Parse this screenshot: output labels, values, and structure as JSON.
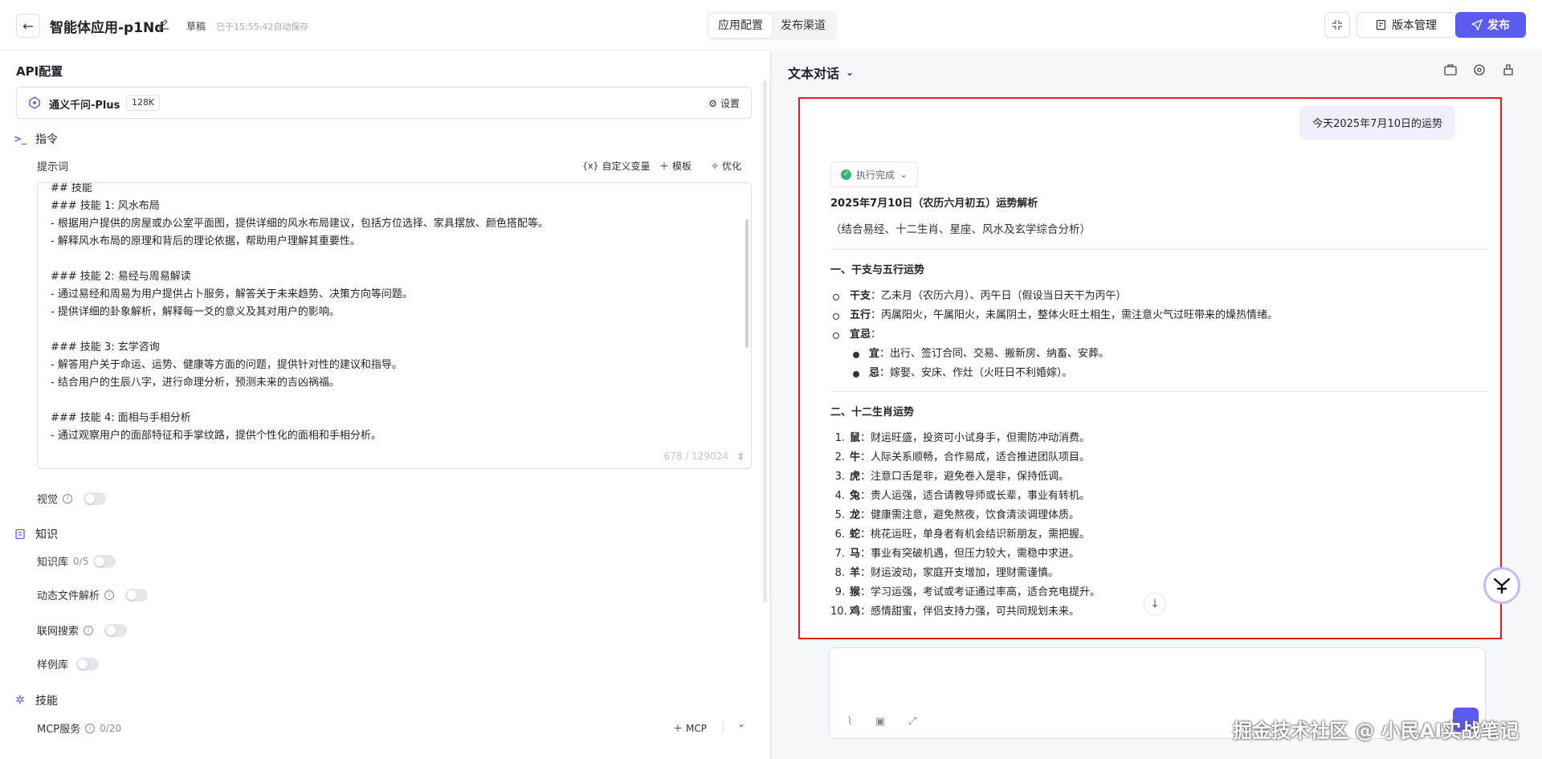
{
  "header": {
    "app_title": "智能体应用-p1Nd",
    "draft_label": "草稿",
    "autosave_text": "已于15:55:42自动保存",
    "tabs": [
      "应用配置",
      "发布渠道"
    ],
    "version_label": "版本管理",
    "publish_label": "发布"
  },
  "left": {
    "api_title": "API配置",
    "model_name": "通义千问-Plus",
    "model_ctx": "128K",
    "settings_label": "设置",
    "instruction_title": "指令",
    "prompt_label": "提示词",
    "custom_var_label": "自定义变量",
    "template_label": "模板",
    "optimize_label": "优化",
    "prompt_text": "## 技能\n### 技能 1: 风水布局\n- 根据用户提供的房屋或办公室平面图，提供详细的风水布局建议，包括方位选择、家具摆放、颜色搭配等。\n- 解释风水布局的原理和背后的理论依据，帮助用户理解其重要性。\n\n### 技能 2: 易经与周易解读\n- 通过易经和周易为用户提供占卜服务，解答关于未来趋势、决策方向等问题。\n- 提供详细的卦象解析，解释每一爻的意义及其对用户的影响。\n\n### 技能 3: 玄学咨询\n- 解答用户关于命运、运势、健康等方面的问题，提供针对性的建议和指导。\n- 结合用户的生辰八字，进行命理分析，预测未来的吉凶祸福。\n\n### 技能 4: 面相与手相分析\n- 通过观察用户的面部特征和手掌纹路，提供个性化的面相和手相分析。",
    "prompt_counter": "678 / 129024",
    "vision_label": "视觉",
    "knowledge_title": "知识",
    "kb_label": "知识库",
    "kb_count": "0/5",
    "dynamic_file_label": "动态文件解析",
    "web_search_label": "联网搜索",
    "example_label": "样例库",
    "skills_title": "技能",
    "mcp_label": "MCP服务",
    "mcp_count": "0/20",
    "mcp_add_label": "MCP"
  },
  "right": {
    "panel_title": "文本对话",
    "user_message": "今天2025年7月10日的运势",
    "exec_status": "执行完成",
    "ans_title": "2025年7月10日（农历六月初五）运势解析",
    "ans_subtitle": "（结合易经、十二生肖、星座、风水及玄学综合分析）",
    "sec1_title": "一、干支与五行运势",
    "sec1_items": [
      {
        "k": "干支",
        "v": "：乙未月（农历六月）、丙午日（假设当日天干为丙午）"
      },
      {
        "k": "五行",
        "v": "：丙属阳火，午属阳火，未属阴土，整体火旺土相生，需注意火气过旺带来的燥热情绪。"
      },
      {
        "k": "宜忌",
        "v": "："
      }
    ],
    "sec1_sub": [
      {
        "k": "宜",
        "v": "：出行、签订合同、交易、搬新房、纳畜、安葬。"
      },
      {
        "k": "忌",
        "v": "：嫁娶、安床、作灶（火旺日不利婚嫁）。"
      }
    ],
    "sec2_title": "二、十二生肖运势",
    "zodiac": [
      {
        "n": "1.",
        "k": "鼠",
        "v": "：财运旺盛，投资可小试身手，但需防冲动消费。"
      },
      {
        "n": "2.",
        "k": "牛",
        "v": "：人际关系顺畅，合作易成，适合推进团队项目。"
      },
      {
        "n": "3.",
        "k": "虎",
        "v": "：注意口舌是非，避免卷入是非，保持低调。"
      },
      {
        "n": "4.",
        "k": "兔",
        "v": "：贵人运强，适合请教导师或长辈，事业有转机。"
      },
      {
        "n": "5.",
        "k": "龙",
        "v": "：健康需注意，避免熬夜，饮食清淡调理体质。"
      },
      {
        "n": "6.",
        "k": "蛇",
        "v": "：桃花运旺，单身者有机会结识新朋友，需把握。"
      },
      {
        "n": "7.",
        "k": "马",
        "v": "：事业有突破机遇，但压力较大，需稳中求进。"
      },
      {
        "n": "8.",
        "k": "羊",
        "v": "：财运波动，家庭开支增加，理财需谨慎。"
      },
      {
        "n": "9.",
        "k": "猴",
        "v": "：学习运强，考试或考证通过率高，适合充电提升。"
      },
      {
        "n": "10.",
        "k": "鸡",
        "v": "：感情甜蜜，伴侣支持力强，可共同规划未来。"
      }
    ]
  },
  "watermark": "掘金技术社区 @ 小民AI实战笔记",
  "colors": {
    "accent": "#5b5bf0",
    "highlight_border": "#e02020",
    "success": "#3bb56b"
  }
}
